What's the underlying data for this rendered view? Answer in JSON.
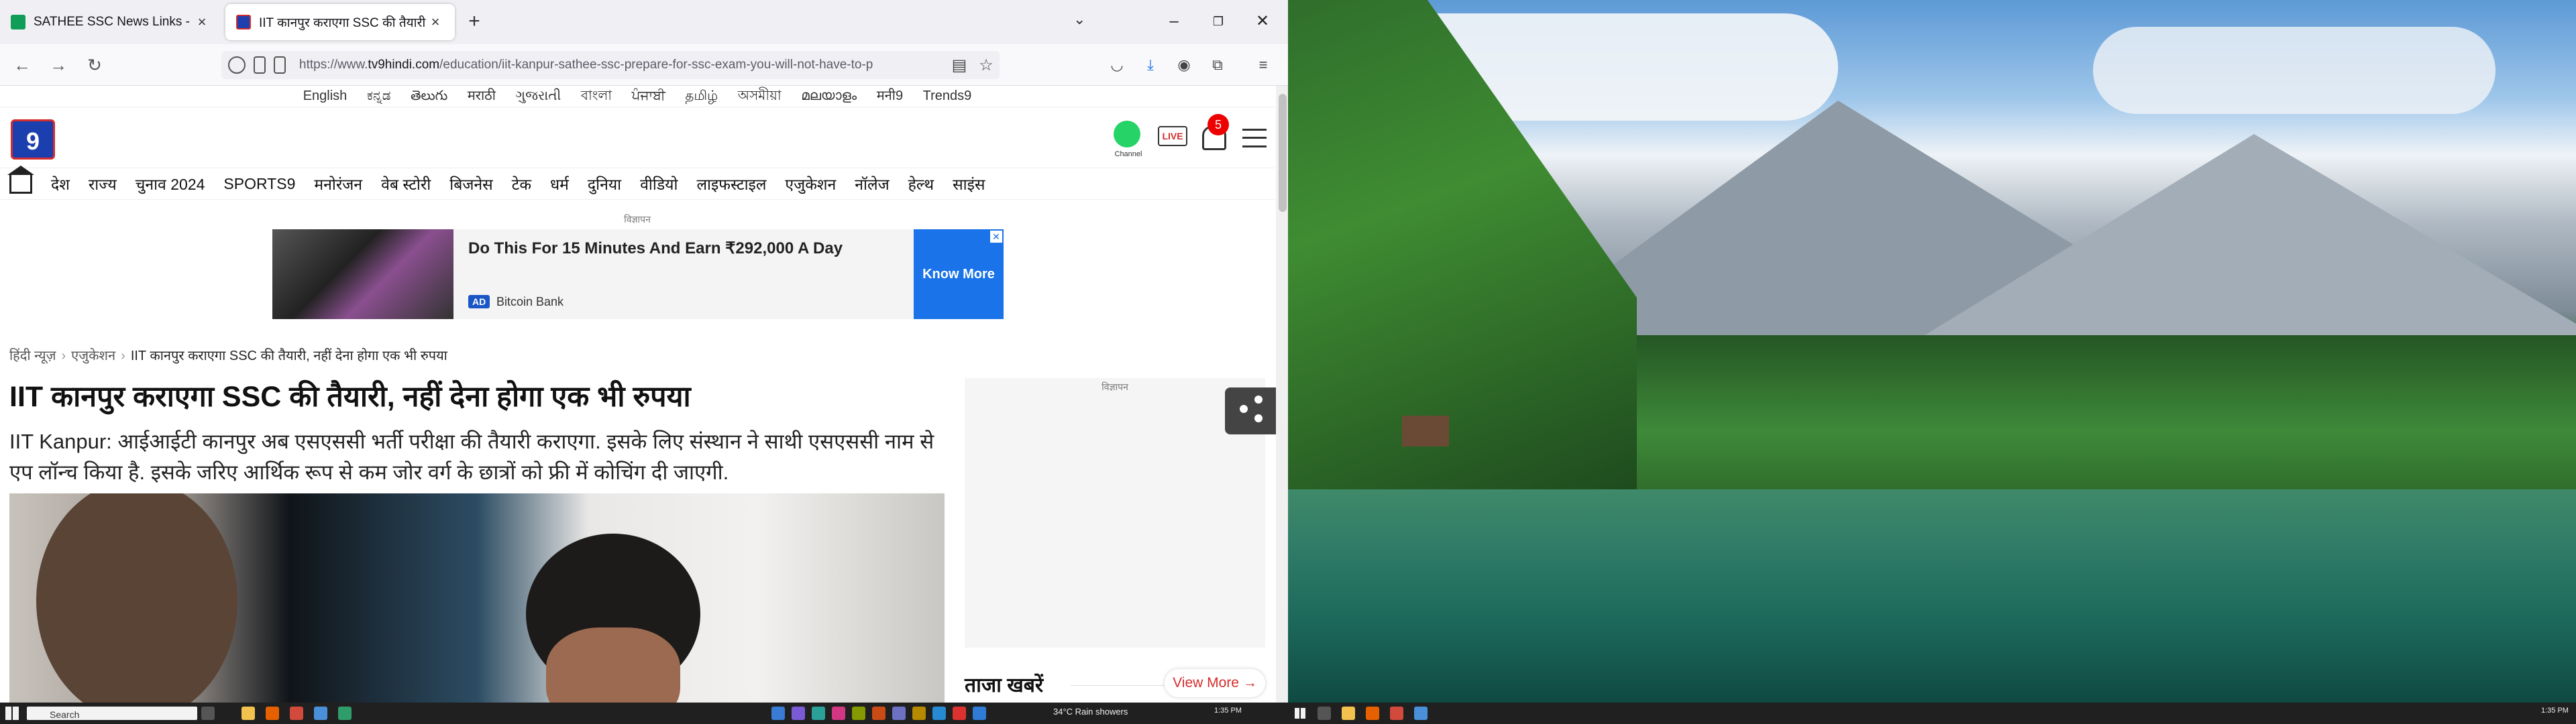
{
  "browser": {
    "tabs": [
      {
        "title": "SATHEE SSC News Links - Goog",
        "active": false
      },
      {
        "title": "IIT कानपुर कराएगा SSC की तैयारी",
        "active": true
      }
    ],
    "url_prefix": "https://www.",
    "url_host": "tv9hindi.com",
    "url_path": "/education/iit-kanpur-sathee-ssc-prepare-for-ssc-exam-you-will-not-have-to-p"
  },
  "languages": [
    "English",
    "ಕನ್ನಡ",
    "తెలుగు",
    "मराठी",
    "ગુજરાતી",
    "বাংলা",
    "ਪੰਜਾਬੀ",
    "தமிழ்",
    "অসমীয়া",
    "മലയാളം",
    "मनी9",
    "Trends9"
  ],
  "header": {
    "logo_text": "9",
    "whatsapp_label": "Channel",
    "live_label": "LIVE",
    "notification_count": "5"
  },
  "nav": [
    "देश",
    "राज्य",
    "चुनाव 2024",
    "SPORTS9",
    "मनोरंजन",
    "वेब स्टोरी",
    "बिजनेस",
    "टेक",
    "धर्म",
    "दुनिया",
    "वीडियो",
    "लाइफस्टाइल",
    "एजुकेशन",
    "नॉलेज",
    "हेल्थ",
    "साइंस"
  ],
  "ad": {
    "label": "विज्ञापन",
    "headline": "Do This For 15 Minutes And Earn ₹292,000 A Day",
    "tag": "AD",
    "sponsor": "Bitcoin Bank",
    "cta": "Know More",
    "close": "✕"
  },
  "breadcrumb": {
    "home": "हिंदी न्यूज़",
    "section": "एजुकेशन",
    "current": "IIT कानपुर कराएगा SSC की तैयारी, नहीं देना होगा एक भी रुपया"
  },
  "article": {
    "title": "IIT कानपुर कराएगा SSC की तैयारी, नहीं देना होगा एक भी रुपया",
    "summary": "IIT Kanpur: आईआईटी कानपुर अब एसएससी भर्ती परीक्षा की तैयारी कराएगा. इसके लिए संस्थान ने साथी एसएससी नाम से एप लॉन्च किया है. इसके जरिए आर्थिक रूप से कम जोर वर्ग के छात्रों को फ्री में कोचिंग दी जाएगी."
  },
  "sidebar": {
    "ad_label": "विज्ञापन",
    "latest_news_title": "ताजा खबरें",
    "view_more": "View More →"
  },
  "taskbar": {
    "search_placeholder": "Search",
    "weather": "34°C  Rain showers",
    "time_left": "1:35 PM",
    "time_right": "1:35 PM"
  },
  "colors": {
    "brand_red": "#d52c2c",
    "tv9_blue": "#1b3faf",
    "ad_cta_blue": "#1a73e8"
  }
}
